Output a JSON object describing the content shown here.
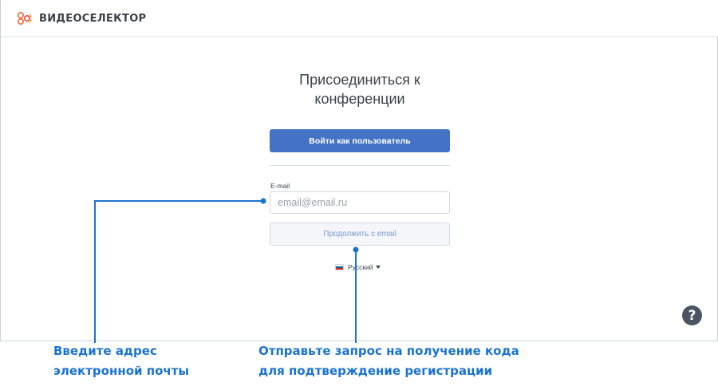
{
  "header": {
    "logo_text": "ВИДЕОСЕЛЕКТОР",
    "logo_icon": "videoselector-logo-icon"
  },
  "join": {
    "title_line1": "Присоединиться к",
    "title_line2": "конференции",
    "login_button_label": "Войти как пользователь",
    "email_label": "E-mail",
    "email_placeholder": "email@email.ru",
    "email_value": "",
    "continue_button_label": "Продолжить с email"
  },
  "language": {
    "selected": "Русский",
    "flag_icon": "russian-flag-icon",
    "caret_icon": "caret-down-icon"
  },
  "help": {
    "label": "?",
    "icon": "help-icon"
  },
  "annotations": [
    {
      "line1": "Введите адрес",
      "line2": "электронной почты"
    },
    {
      "line1": "Отправьте запрос на получение кода",
      "line2": "для подтверждение регистрации"
    }
  ],
  "colors": {
    "primary": "#4472c4",
    "callout": "#1a73d1",
    "help_bg": "#4a5561",
    "logo_accent": "#f06b35"
  }
}
